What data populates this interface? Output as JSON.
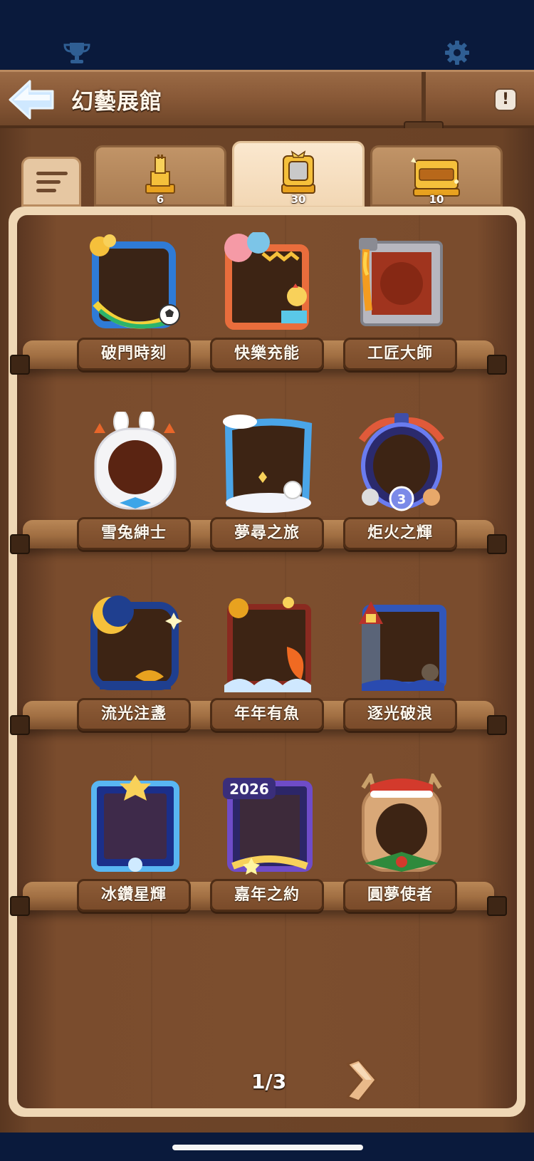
{
  "header": {
    "title": "幻藝展館",
    "help_label": "!"
  },
  "top_icons": [
    "trophy-icon",
    "gear-icon"
  ],
  "tabs": [
    {
      "icon": "gold-tower-frame-icon",
      "count": "6",
      "active": false
    },
    {
      "icon": "gold-portrait-frame-icon",
      "count": "30",
      "active": true
    },
    {
      "icon": "gold-nameplate-frame-icon",
      "count": "10",
      "active": false
    }
  ],
  "frames": [
    {
      "name": "破門時刻",
      "icon": "soccer-frame-icon"
    },
    {
      "name": "快樂充能",
      "icon": "balloon-party-frame-icon"
    },
    {
      "name": "工匠大師",
      "icon": "metal-pipe-frame-icon"
    },
    {
      "name": "雪兔紳士",
      "icon": "snow-bunny-frame-icon"
    },
    {
      "name": "夢尋之旅",
      "icon": "cloud-cat-frame-icon"
    },
    {
      "name": "炬火之輝",
      "icon": "torch-rank-frame-icon"
    },
    {
      "name": "流光注盞",
      "icon": "moon-lamp-frame-icon"
    },
    {
      "name": "年年有魚",
      "icon": "koi-fish-frame-icon"
    },
    {
      "name": "逐光破浪",
      "icon": "lighthouse-frame-icon"
    },
    {
      "name": "冰鑽星輝",
      "icon": "ice-diamond-frame-icon"
    },
    {
      "name": "嘉年之約",
      "icon": "year-2026-frame-icon"
    },
    {
      "name": "圓夢使者",
      "icon": "reindeer-frame-icon"
    }
  ],
  "frame_badges": {
    "year_text": "2026",
    "rank_number": "3"
  },
  "pagination": {
    "label": "1/3"
  }
}
